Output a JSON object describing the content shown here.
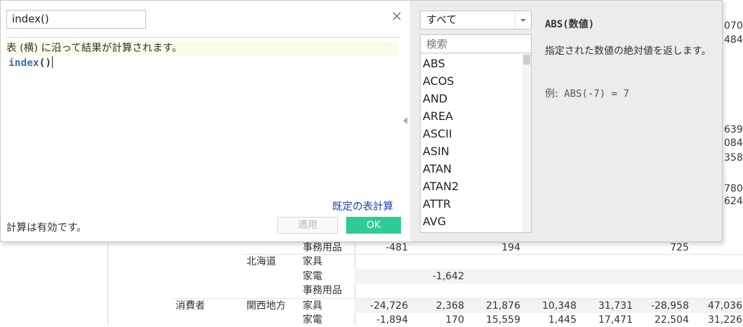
{
  "dialog": {
    "calc_name": "index()",
    "comment": "表 (横) に沿って結果が計算されます。",
    "formula_fn": "index",
    "formula_parens": "()",
    "default_calc_link": "既定の表計算",
    "status": "計算は有効です。",
    "apply_label": "適用",
    "ok_label": "OK",
    "category": "すべて",
    "search_placeholder": "検索",
    "functions": [
      "ABS",
      "ACOS",
      "AND",
      "AREA",
      "ASCII",
      "ASIN",
      "ATAN",
      "ATAN2",
      "ATTR",
      "AVG"
    ],
    "help": {
      "title": "ABS(数値)",
      "body": "指定された数値の絶対値を返します。",
      "example_label": "例:",
      "example_code": "ABS(-7) = 7"
    }
  },
  "sheet": {
    "right_edge_values": [
      "070",
      "484",
      "639",
      "084",
      "358",
      "780",
      "624"
    ],
    "rows": [
      {
        "segment": "",
        "region": "",
        "category": "事務用品",
        "values": [
          "-481",
          "",
          "194",
          "",
          "",
          "725",
          ""
        ]
      },
      {
        "segment": "",
        "region": "北海道",
        "category": "家具",
        "values": [
          "",
          "",
          "",
          "",
          "",
          "",
          ""
        ]
      },
      {
        "segment": "",
        "region": "",
        "category": "家電",
        "values": [
          "",
          "-1,642",
          "",
          "",
          "",
          "",
          ""
        ]
      },
      {
        "segment": "",
        "region": "",
        "category": "事務用品",
        "values": [
          "",
          "",
          "",
          "",
          "",
          "",
          ""
        ]
      },
      {
        "segment": "消費者",
        "region": "関西地方",
        "category": "家具",
        "values": [
          "-24,726",
          "2,368",
          "21,876",
          "10,348",
          "31,731",
          "-28,958",
          "47,036"
        ]
      },
      {
        "segment": "",
        "region": "",
        "category": "家電",
        "values": [
          "-1,894",
          "170",
          "15,559",
          "1,445",
          "17,471",
          "22,504",
          "31,226"
        ]
      }
    ]
  },
  "colors": {
    "ok_button": "#2fcb96",
    "link": "#1e3cc8",
    "function_keyword": "#3d6ea5",
    "comment_bg": "#fbfbe7",
    "right_panel_bg": "#ececec"
  }
}
